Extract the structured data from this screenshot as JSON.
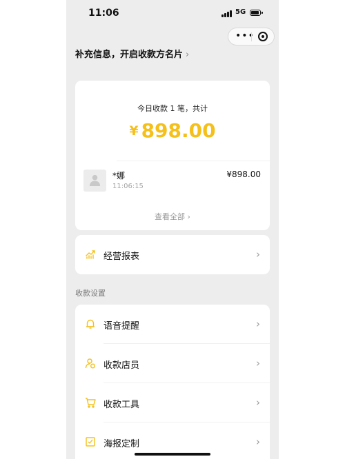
{
  "status_bar": {
    "time": "11:06",
    "network": "5G"
  },
  "menu_capsule": {
    "more_icon": "more-dots-icon",
    "target_icon": "target-icon"
  },
  "header": {
    "supplement_text": "补充信息，开启收款方名片",
    "chevron": "›"
  },
  "today_card": {
    "summary": "今日收款 1 笔，共计",
    "currency": "¥",
    "amount": "898.00",
    "transaction": {
      "payer": "*娜",
      "time": "11:06:15",
      "amount": "¥898.00"
    },
    "view_all": "查看全部 ›"
  },
  "report": {
    "label": "经营报表",
    "icon": "trend-chart-icon"
  },
  "settings": {
    "section_title": "收款设置",
    "items": [
      {
        "label": "语音提醒",
        "icon": "bell-icon"
      },
      {
        "label": "收款店员",
        "icon": "clerk-icon"
      },
      {
        "label": "收款工具",
        "icon": "cart-icon"
      },
      {
        "label": "海报定制",
        "icon": "poster-icon"
      }
    ]
  },
  "colors": {
    "accent": "#f5c01a",
    "background": "#ededed",
    "card": "#ffffff"
  }
}
